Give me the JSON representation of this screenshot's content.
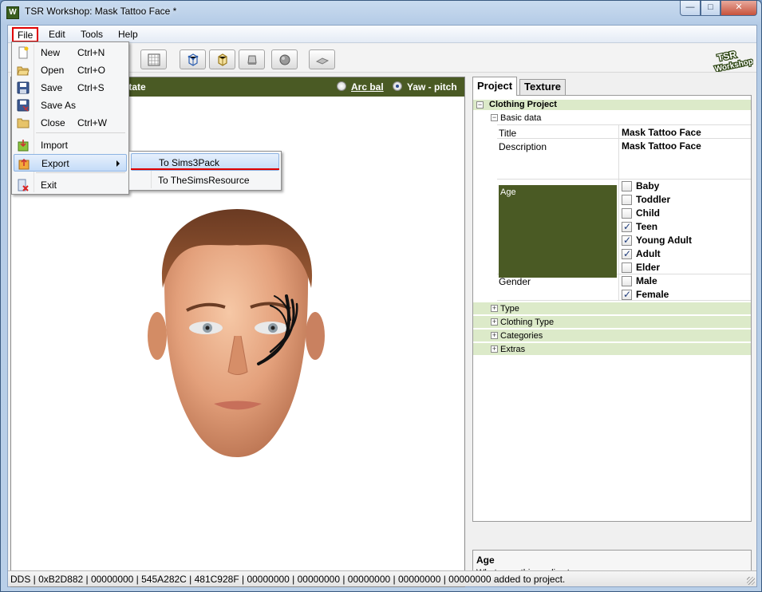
{
  "window": {
    "title": "TSR Workshop: Mask Tattoo Face *",
    "icon_letter": "W",
    "controls": {
      "minimize": "—",
      "maximize": "□",
      "close": "✕"
    }
  },
  "menubar": {
    "file": "File",
    "edit": "Edit",
    "tools": "Tools",
    "help": "Help"
  },
  "file_menu": {
    "items": [
      {
        "label": "New",
        "shortcut": "Ctrl+N",
        "icon": "new-document-icon"
      },
      {
        "label": "Open",
        "shortcut": "Ctrl+O",
        "icon": "open-folder-icon"
      },
      {
        "label": "Save",
        "shortcut": "Ctrl+S",
        "icon": "floppy-disk-icon"
      },
      {
        "label": "Save As",
        "shortcut": "",
        "icon": "save-as-icon"
      },
      {
        "label": "Close",
        "shortcut": "Ctrl+W",
        "icon": "close-folder-icon"
      },
      {
        "label": "Import",
        "shortcut": "",
        "icon": "import-icon"
      },
      {
        "label": "Export",
        "shortcut": "",
        "icon": "export-icon"
      },
      {
        "label": "Exit",
        "shortcut": "",
        "icon": "exit-icon"
      }
    ]
  },
  "export_submenu": {
    "items": [
      {
        "label": "To Sims3Pack"
      },
      {
        "label": "To TheSimsResource"
      }
    ]
  },
  "viewport": {
    "mode_label": "otate",
    "arc_ball": "Arc bal",
    "yaw_pitch": "Yaw - pitch",
    "selected_mode": "Yaw - pitch"
  },
  "tabs": {
    "project": "Project",
    "texture": "Texture"
  },
  "property_grid": {
    "root": "Clothing Project",
    "basic_data": "Basic data",
    "title_label": "Title",
    "title_value": "Mask Tattoo Face",
    "description_label": "Description",
    "description_value": "Mask Tattoo Face",
    "age_label": "Age",
    "ages": [
      {
        "label": "Baby",
        "checked": false
      },
      {
        "label": "Toddler",
        "checked": false
      },
      {
        "label": "Child",
        "checked": false
      },
      {
        "label": "Teen",
        "checked": true
      },
      {
        "label": "Young Adult",
        "checked": true
      },
      {
        "label": "Adult",
        "checked": true
      },
      {
        "label": "Elder",
        "checked": false
      }
    ],
    "gender_label": "Gender",
    "genders": [
      {
        "label": "Male",
        "checked": false
      },
      {
        "label": "Female",
        "checked": true
      }
    ],
    "collapsed": [
      "Type",
      "Clothing Type",
      "Categories",
      "Extras"
    ]
  },
  "help": {
    "title": "Age",
    "description": "What ages this applies to."
  },
  "statusbar": {
    "text": "DDS | 0xB2D882 | 00000000 | 545A282C | 481C928F | 00000000 | 00000000 | 00000000 | 00000000 | 00000000 added to project."
  },
  "logo": {
    "line1": "TSR",
    "line2": "Workshop"
  },
  "colors": {
    "accent_green": "#4a5a24",
    "category_green": "#dceac9",
    "highlight_red": "#e00000"
  }
}
